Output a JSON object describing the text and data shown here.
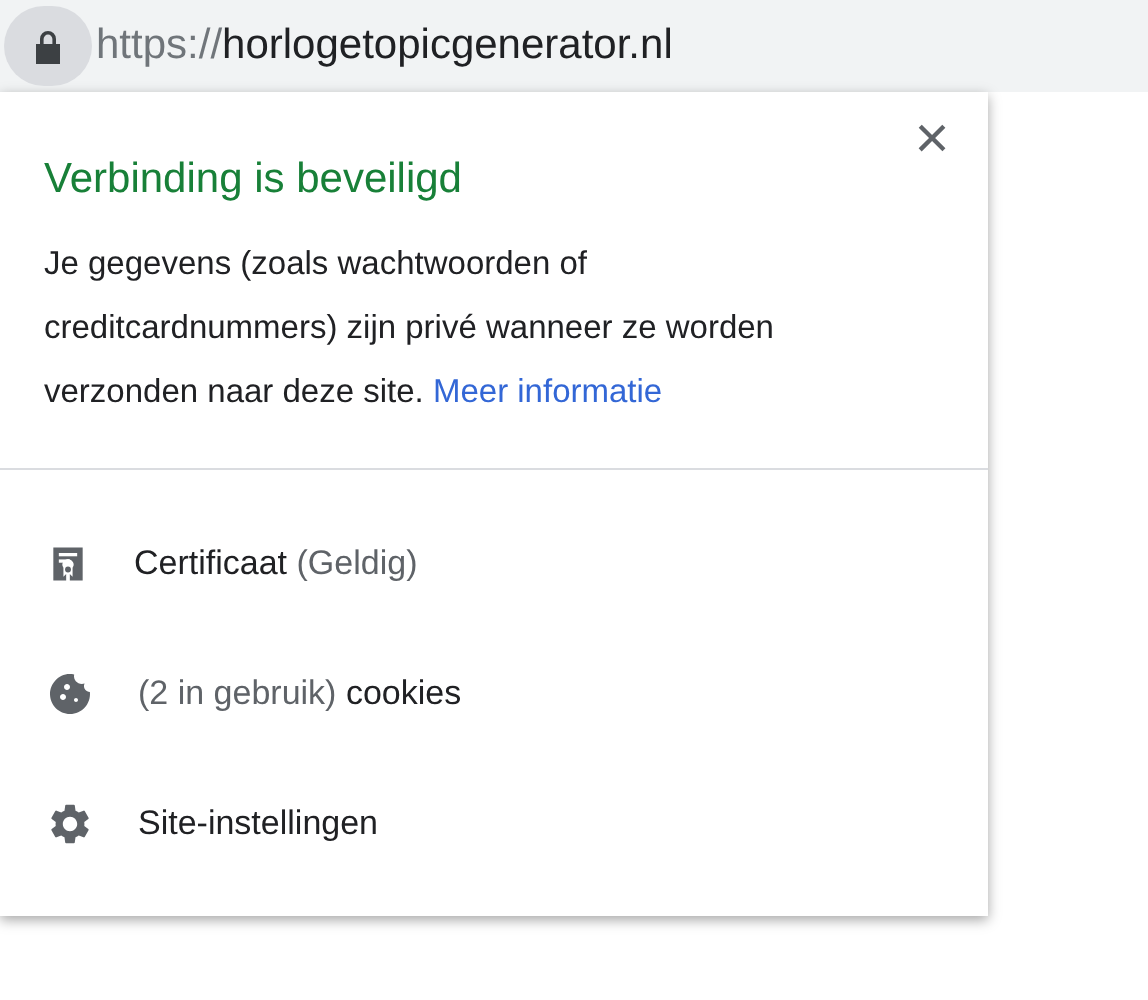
{
  "address_bar": {
    "scheme": "https://",
    "host": "horlogetopicgenerator.nl"
  },
  "popup": {
    "title": "Verbinding is beveiligd",
    "body": "Je gegevens (zoals wachtwoorden of creditcardnummers) zijn privé wanneer ze worden verzonden naar deze site.",
    "link": "Meer informatie",
    "close": "×",
    "items": [
      {
        "kind": "certificate",
        "parts": [
          {
            "text": "Certificaat",
            "muted": false
          },
          {
            "text": "(Geldig)",
            "muted": true
          }
        ]
      },
      {
        "kind": "cookies",
        "parts": [
          {
            "text": "(2 in gebruik)",
            "muted": true
          },
          {
            "text": "cookies",
            "muted": false
          }
        ]
      },
      {
        "kind": "settings",
        "parts": [
          {
            "text": "Site-instellingen",
            "muted": false
          }
        ]
      }
    ]
  }
}
